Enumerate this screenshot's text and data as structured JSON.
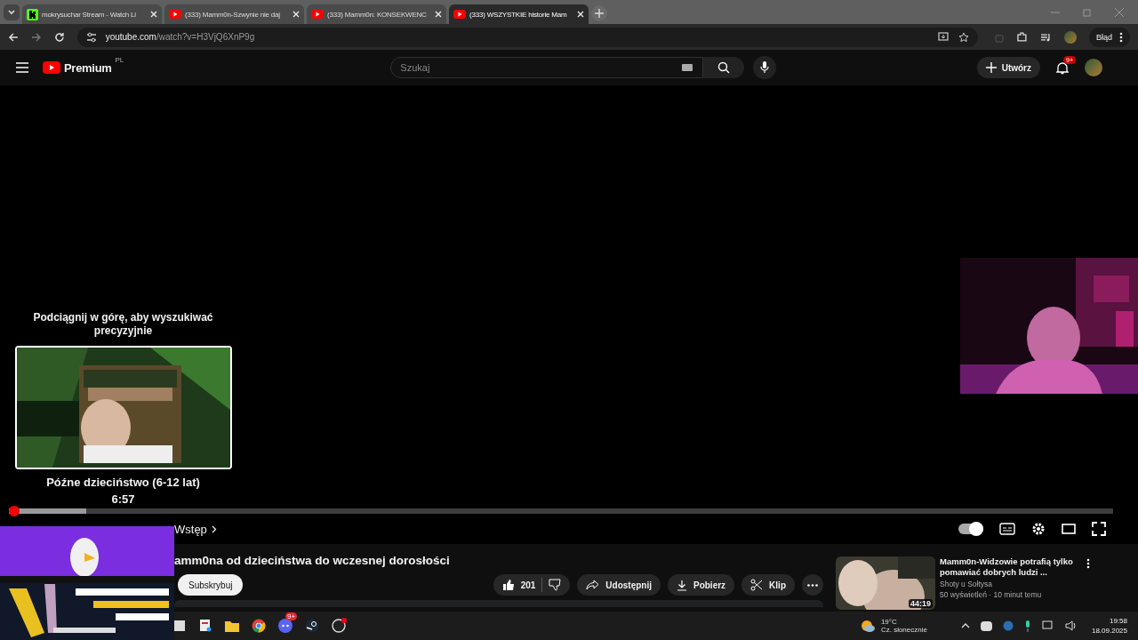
{
  "browser": {
    "tabs": [
      {
        "title": "mokrysuchar Stream - Watch Li",
        "kind": "kick",
        "selected": false
      },
      {
        "title": "(333) Mamm0n-Szwynie nie daj",
        "kind": "youtube",
        "selected": false
      },
      {
        "title": "(333) Mamm0n: KONSEKWENC",
        "kind": "youtube",
        "selected": false
      },
      {
        "title": "(333) WSZYSTKIE historie Mam",
        "kind": "youtube",
        "selected": true
      }
    ],
    "url_host": "youtube.com",
    "url_path": "/watch?v=H3VjQ6XnP9g",
    "profile_button": "Błąd"
  },
  "header": {
    "logo": "Premium",
    "logo_region": "PL",
    "search_placeholder": "Szukaj",
    "create_button": "Utwórz",
    "notifications_badge": "9+"
  },
  "player": {
    "seek_hint": "Podciągnij w górę, aby wyszukiwać precyzyjnie",
    "preview_chapter": "Późne dzieciństwo (6-12 lat)",
    "preview_time": "6:57",
    "played": {
      "level": 0.0
    },
    "hovered": {
      "level": 0.07
    },
    "chapter": "Wstęp",
    "autoplay": {
      "on": true
    }
  },
  "video": {
    "title": "amm0na od dzieciństwa do wczesnej dorosłości",
    "subscribe_button": "Subskrybuj",
    "likes": "201",
    "share_button": "Udostępnij",
    "download_button": "Pobierz",
    "clip_button": "Klip"
  },
  "recommended": [
    {
      "title": "Mamm0n-Widzowie potrafią tylko pomawiać dobrych ludzi ...",
      "channel": "Shoty u Sołtysa",
      "meta": "50 wyświetleń · 10 minut temu",
      "duration": "44:19"
    }
  ],
  "taskbar": {
    "weather_temp": "19°C",
    "weather_text": "Cz. słonecznie",
    "time": "19:58",
    "date": "18.09.2025",
    "discord_badge": "9+"
  }
}
